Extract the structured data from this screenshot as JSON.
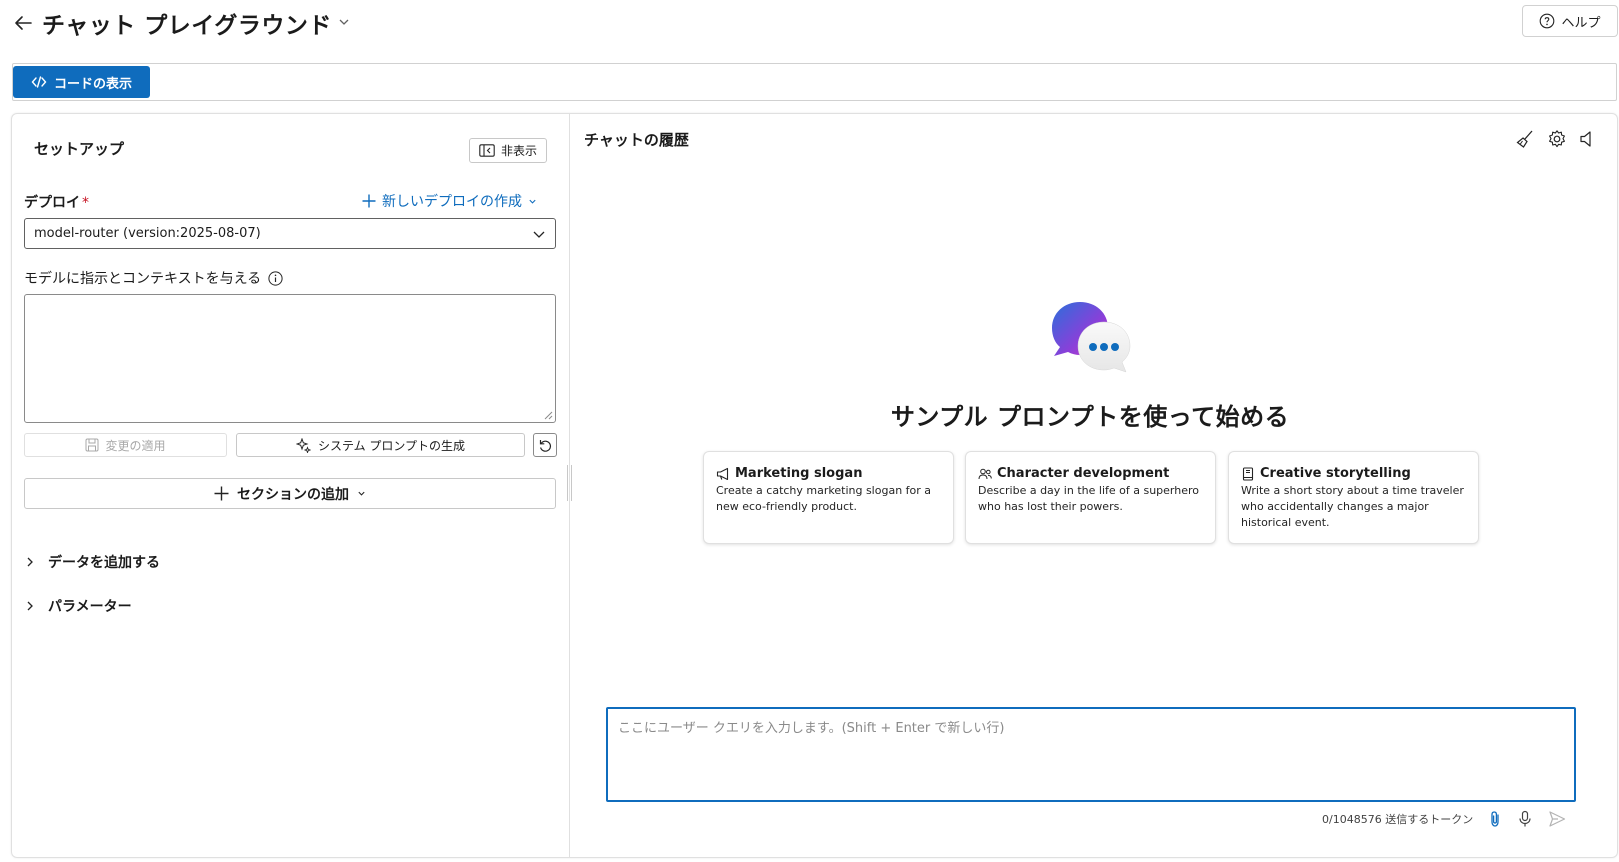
{
  "header": {
    "title": "チャット プレイグラウンド",
    "help_label": "ヘルプ"
  },
  "toolbar": {
    "view_code_label": "コードの表示"
  },
  "setup": {
    "title": "セットアップ",
    "hide_label": "非表示",
    "deploy_label": "デプロイ",
    "required_mark": "*",
    "new_deploy_label": "新しいデプロイの作成",
    "deploy_selected": "model-router (version:2025-08-07)",
    "instructions_label": "モデルに指示とコンテキストを与える",
    "system_message_value": "",
    "apply_label": "変更の適用",
    "generate_prompt_label": "システム プロンプトの生成",
    "add_section_label": "セクションの追加",
    "accordions": [
      {
        "label": "データを追加する"
      },
      {
        "label": "パラメーター"
      }
    ]
  },
  "chat": {
    "title": "チャットの履歴",
    "empty_title": "サンプル プロンプトを使って始める",
    "cards": [
      {
        "title": "Marketing slogan",
        "body": "Create a catchy marketing slogan for a new eco-friendly product.",
        "icon": "megaphone-icon"
      },
      {
        "title": "Character development",
        "body": "Describe a day in the life of a superhero who has lost their powers.",
        "icon": "people-icon"
      },
      {
        "title": "Creative storytelling",
        "body": "Write a short story about a time traveler who accidentally changes a major historical event.",
        "icon": "book-icon"
      }
    ],
    "input_placeholder": "ここにユーザー クエリを入力します。(Shift + Enter で新しい行)",
    "token_count": "0/1048576 送信するトークン"
  },
  "colors": {
    "accent": "#0f6cbd",
    "required": "#c50f1f",
    "border": "#d1d1d1",
    "illustration_gradient": [
      "#8b3fd9",
      "#2a6fdb"
    ]
  }
}
